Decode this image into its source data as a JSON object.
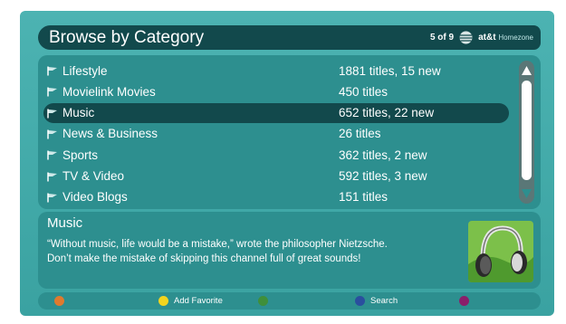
{
  "header": {
    "title": "Browse by Category",
    "page_indicator": "5 of 9",
    "brand": "at&t",
    "brand_sub": "Homezone"
  },
  "categories": [
    {
      "name": "Lifestyle",
      "count": "1881 titles, 15 new",
      "selected": false
    },
    {
      "name": "Movielink Movies",
      "count": "450 titles",
      "selected": false
    },
    {
      "name": "Music",
      "count": "652 titles, 22 new",
      "selected": true
    },
    {
      "name": "News & Business",
      "count": "26 titles",
      "selected": false
    },
    {
      "name": "Sports",
      "count": "362 titles, 2 new",
      "selected": false
    },
    {
      "name": "TV & Video",
      "count": "592 titles, 3 new",
      "selected": false
    },
    {
      "name": "Video Blogs",
      "count": "151 titles",
      "selected": false
    }
  ],
  "description": {
    "title": "Music",
    "line1": "“Without music, life would be a mistake,” wrote the philosopher Nietzsche.",
    "line2": "Don’t make the mistake of skipping this channel full of great sounds!",
    "thumbnail_icon": "headphones-icon"
  },
  "footer": {
    "buttons": [
      {
        "color": "#e07a2e",
        "label": ""
      },
      {
        "color": "#f2d41f",
        "label": "Add Favorite"
      },
      {
        "color": "#3f8f3a",
        "label": ""
      },
      {
        "color": "#2a4f9e",
        "label": "Search"
      },
      {
        "color": "#8a1f6a",
        "label": ""
      }
    ]
  },
  "colors": {
    "background": "#3fa6a6",
    "panel": "#2d8f8f",
    "header_bar": "#12494c",
    "selected_row": "#12494c"
  }
}
